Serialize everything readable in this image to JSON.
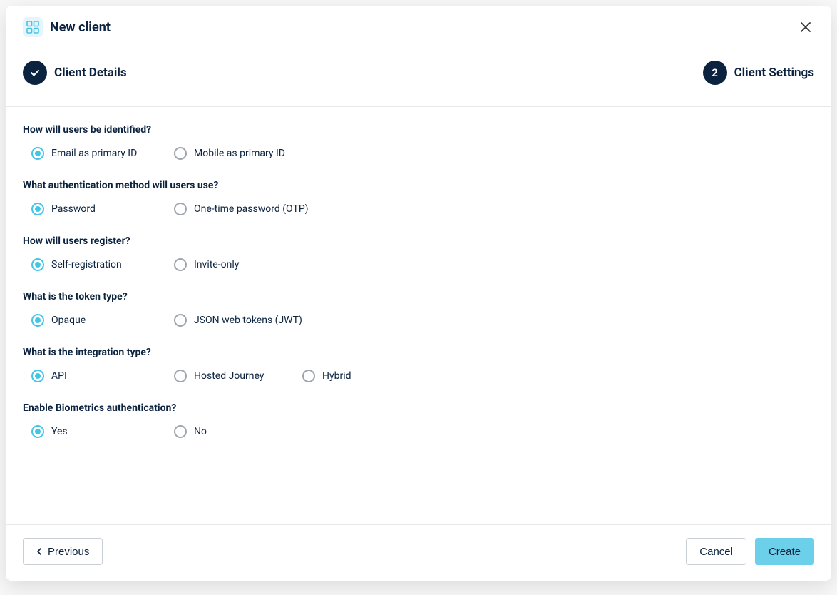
{
  "header": {
    "title": "New client"
  },
  "stepper": {
    "step1": {
      "label": "Client Details",
      "completed": true
    },
    "step2": {
      "number": "2",
      "label": "Client Settings"
    }
  },
  "questions": {
    "identify": {
      "label": "How will users be identified?",
      "options": {
        "email": "Email as primary ID",
        "mobile": "Mobile as primary ID"
      }
    },
    "auth": {
      "label": "What authentication method will users use?",
      "options": {
        "password": "Password",
        "otp": "One-time password (OTP)"
      }
    },
    "register": {
      "label": "How will users register?",
      "options": {
        "self": "Self-registration",
        "invite": "Invite-only"
      }
    },
    "token": {
      "label": "What is the token type?",
      "options": {
        "opaque": "Opaque",
        "jwt": "JSON web tokens (JWT)"
      }
    },
    "integration": {
      "label": "What is the integration type?",
      "options": {
        "api": "API",
        "hosted": "Hosted Journey",
        "hybrid": "Hybrid"
      }
    },
    "biometrics": {
      "label": "Enable Biometrics authentication?",
      "options": {
        "yes": "Yes",
        "no": "No"
      }
    }
  },
  "footer": {
    "previous": "Previous",
    "cancel": "Cancel",
    "create": "Create"
  }
}
